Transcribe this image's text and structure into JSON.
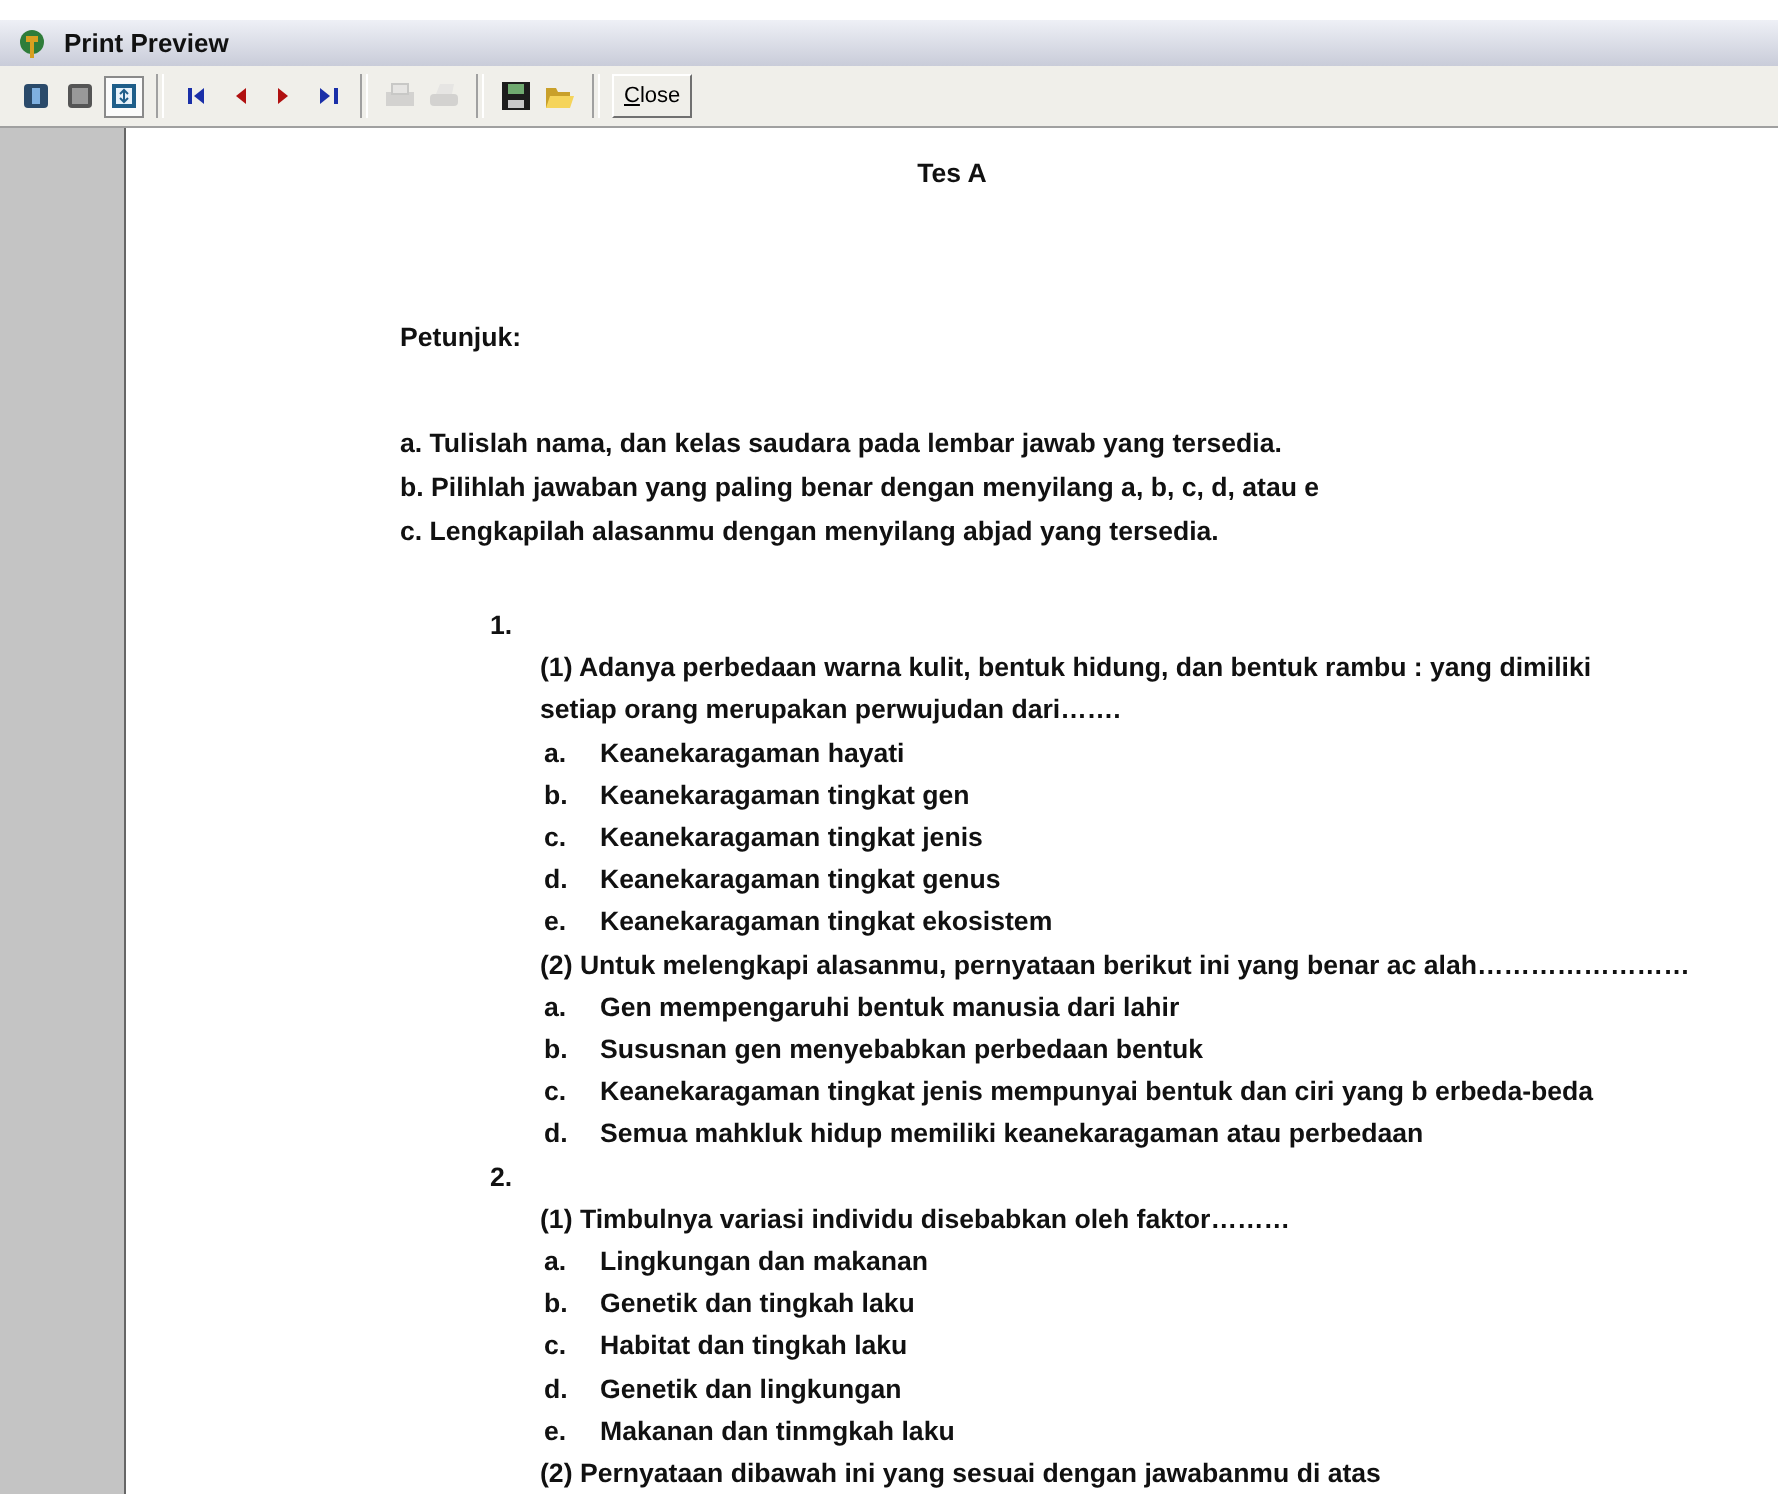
{
  "window": {
    "title": "Print Preview"
  },
  "toolbar": [
    {
      "kind": "one-page",
      "selected": false,
      "disabled": false
    },
    {
      "kind": "two-page",
      "selected": false,
      "disabled": false
    },
    {
      "kind": "zoom",
      "selected": true,
      "disabled": false
    },
    {
      "kind": "separator"
    },
    {
      "kind": "first",
      "selected": false,
      "disabled": false
    },
    {
      "kind": "prev",
      "selected": false,
      "disabled": false
    },
    {
      "kind": "next",
      "selected": false,
      "disabled": false
    },
    {
      "kind": "last",
      "selected": false,
      "disabled": false
    },
    {
      "kind": "separator"
    },
    {
      "kind": "print-setup",
      "selected": false,
      "disabled": true
    },
    {
      "kind": "print",
      "selected": false,
      "disabled": true
    },
    {
      "kind": "separator"
    },
    {
      "kind": "save",
      "selected": false,
      "disabled": false
    },
    {
      "kind": "open",
      "selected": false,
      "disabled": false
    },
    {
      "kind": "separator"
    },
    {
      "kind": "text",
      "label": "Close",
      "selected": false,
      "disabled": false
    }
  ],
  "document": {
    "title": "Tes A",
    "heading": "Petunjuk:",
    "instructions": [
      "a. Tulislah nama, dan  kelas saudara pada lembar jawab yang tersedia.",
      "b. Pilihlah jawaban yang paling benar dengan menyilang a, b, c, d, atau e",
      "c. Lengkapilah alasanmu dengan menyilang abjad yang tersedia."
    ],
    "questions": [
      {
        "number": "1.",
        "parts": [
          {
            "lines": [
              "(1) Adanya perbedaan warna kulit, bentuk hidung, dan bentuk rambu : yang dimiliki",
              "setiap orang merupakan perwujudan dari……."
            ],
            "options": [
              {
                "letter": "a.",
                "text": "Keanekaragaman hayati"
              },
              {
                "letter": "b.",
                "text": "Keanekaragaman tingkat gen"
              },
              {
                "letter": "c.",
                "text": "Keanekaragaman tingkat jenis"
              },
              {
                "letter": "d.",
                "text": "Keanekaragaman tingkat genus"
              },
              {
                "letter": "e.",
                "text": "Keanekaragaman tingkat ekosistem"
              }
            ]
          },
          {
            "lines": [
              "(2) Untuk melengkapi alasanmu, pernyataan berikut ini yang benar ac alah……………………"
            ],
            "options": [
              {
                "letter": "a.",
                "text": "Gen mempengaruhi bentuk manusia dari lahir"
              },
              {
                "letter": "b.",
                "text": "Sususnan gen menyebabkan perbedaan bentuk"
              },
              {
                "letter": "c.",
                "text": "Keanekaragaman tingkat jenis mempunyai bentuk dan ciri yang b erbeda-beda"
              },
              {
                "letter": "d.",
                "text": "Semua mahkluk hidup memiliki keanekaragaman atau perbedaan"
              }
            ]
          }
        ]
      },
      {
        "number": "2.",
        "parts": [
          {
            "lines": [
              "(1) Timbulnya variasi individu disebabkan oleh faktor………"
            ],
            "options": [
              {
                "letter": "a.",
                "text": "Lingkungan dan makanan"
              },
              {
                "letter": "b.",
                "text": "Genetik dan tingkah laku"
              },
              {
                "letter": "c.",
                "text": "Habitat dan tingkah laku"
              },
              {
                "letter": "d.",
                "text": "Genetik dan lingkungan"
              },
              {
                "letter": "e.",
                "text": "Makanan dan tinmgkah laku"
              }
            ]
          },
          {
            "lines": [
              "(2) Pernyataan dibawah ini yang sesuai dengan jawabanmu di atas"
            ]
          }
        ]
      }
    ]
  }
}
